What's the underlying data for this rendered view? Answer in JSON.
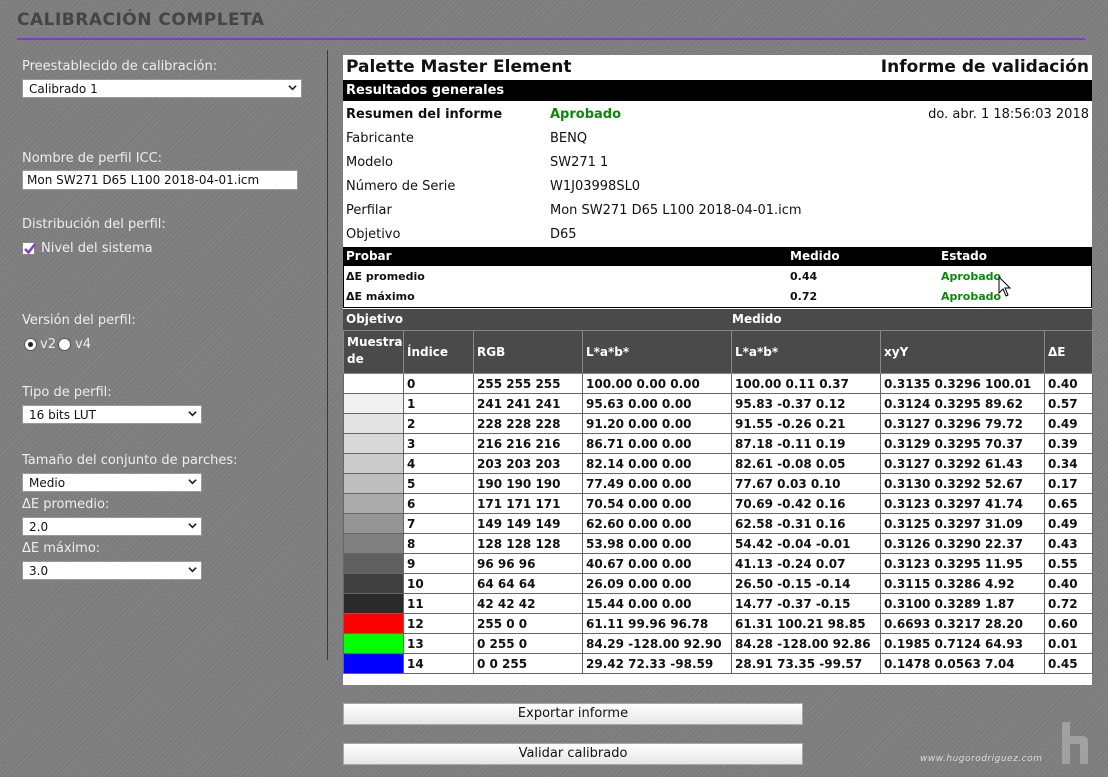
{
  "window": {
    "title": "CALIBRACIÓN COMPLETA"
  },
  "sidebar": {
    "preset_label": "Preestablecido de calibración:",
    "preset_value": "Calibrado 1",
    "icc_label": "Nombre de perfil ICC:",
    "icc_value": "Mon SW271 D65 L100 2018-04-01.icm",
    "distribution_label": "Distribución del perfil:",
    "system_level_label": "Nivel del sistema",
    "system_level_checked": true,
    "version_label": "Versión del perfil:",
    "version_options": [
      "v2",
      "v4"
    ],
    "version_selected": "v2",
    "profile_type_label": "Tipo de perfil:",
    "profile_type_value": "16 bits LUT",
    "patch_size_label": "Tamaño del conjunto de parches:",
    "patch_size_value": "Medio",
    "avg_de_label": "ΔE promedio:",
    "avg_de_value": "2.0",
    "max_de_label": "ΔE máximo:",
    "max_de_value": "3.0"
  },
  "report": {
    "app_title": "Palette Master Element",
    "report_title": "Informe de validación",
    "general_results": "Resultados generales",
    "summary_label": "Resumen del informe",
    "summary_status": "Aprobado",
    "timestamp": "do. abr. 1 18:56:03 2018",
    "info": [
      {
        "label": "Fabricante",
        "value": "BENQ"
      },
      {
        "label": "Modelo",
        "value": "SW271 1"
      },
      {
        "label": "Número de Serie",
        "value": "W1J03998SL0"
      },
      {
        "label": "Perfilar",
        "value": "Mon SW271 D65 L100 2018-04-01.icm"
      },
      {
        "label": "Objetivo",
        "value": "D65"
      }
    ],
    "test_header": {
      "probe": "Probar",
      "measured": "Medido",
      "status": "Estado"
    },
    "tests": [
      {
        "name": "ΔE promedio",
        "measured": "0.44",
        "status": "Aprobado"
      },
      {
        "name": "ΔE máximo",
        "measured": "0.72",
        "status": "Aprobado"
      }
    ],
    "target_label": "Objetivo",
    "measured_label": "Medido",
    "columns": {
      "sample": "Muestra de",
      "index": "Índice",
      "rgb": "RGB",
      "lab_target": "L*a*b*",
      "lab_measured": "L*a*b*",
      "xyy": "xyY",
      "de": "ΔE"
    },
    "rows": [
      {
        "color": "#ffffff",
        "idx": "0",
        "rgb": "255  255  255",
        "lab_t": "100.00  0.00  0.00",
        "lab_m": "100.00  0.11  0.37",
        "xyy": "0.3135  0.3296  100.01",
        "de": "0.40"
      },
      {
        "color": "#f1f1f1",
        "idx": "1",
        "rgb": "241  241  241",
        "lab_t": "95.63  0.00  0.00",
        "lab_m": "95.83  -0.37  0.12",
        "xyy": "0.3124  0.3295  89.62",
        "de": "0.57"
      },
      {
        "color": "#e4e4e4",
        "idx": "2",
        "rgb": "228  228  228",
        "lab_t": "91.20  0.00  0.00",
        "lab_m": "91.55  -0.26  0.21",
        "xyy": "0.3127  0.3296  79.72",
        "de": "0.49"
      },
      {
        "color": "#d8d8d8",
        "idx": "3",
        "rgb": "216  216  216",
        "lab_t": "86.71  0.00  0.00",
        "lab_m": "87.18  -0.11  0.19",
        "xyy": "0.3129  0.3295  70.37",
        "de": "0.39"
      },
      {
        "color": "#cbcbcb",
        "idx": "4",
        "rgb": "203  203  203",
        "lab_t": "82.14  0.00  0.00",
        "lab_m": "82.61  -0.08  0.05",
        "xyy": "0.3127  0.3292  61.43",
        "de": "0.34"
      },
      {
        "color": "#bebebe",
        "idx": "5",
        "rgb": "190  190  190",
        "lab_t": "77.49  0.00  0.00",
        "lab_m": "77.67  0.03  0.10",
        "xyy": "0.3130  0.3292  52.67",
        "de": "0.17"
      },
      {
        "color": "#ababab",
        "idx": "6",
        "rgb": "171  171  171",
        "lab_t": "70.54  0.00  0.00",
        "lab_m": "70.69  -0.42  0.16",
        "xyy": "0.3123  0.3297  41.74",
        "de": "0.65"
      },
      {
        "color": "#959595",
        "idx": "7",
        "rgb": "149  149  149",
        "lab_t": "62.60  0.00  0.00",
        "lab_m": "62.58  -0.31  0.16",
        "xyy": "0.3125  0.3297  31.09",
        "de": "0.49"
      },
      {
        "color": "#808080",
        "idx": "8",
        "rgb": "128  128  128",
        "lab_t": "53.98  0.00  0.00",
        "lab_m": "54.42  -0.04  -0.01",
        "xyy": "0.3126  0.3290  22.37",
        "de": "0.43"
      },
      {
        "color": "#606060",
        "idx": "9",
        "rgb": "96  96  96",
        "lab_t": "40.67  0.00  0.00",
        "lab_m": "41.13  -0.24  0.07",
        "xyy": "0.3123  0.3295  11.95",
        "de": "0.55"
      },
      {
        "color": "#404040",
        "idx": "10",
        "rgb": "64  64  64",
        "lab_t": "26.09  0.00  0.00",
        "lab_m": "26.50  -0.15  -0.14",
        "xyy": "0.3115  0.3286  4.92",
        "de": "0.40"
      },
      {
        "color": "#2a2a2a",
        "idx": "11",
        "rgb": "42  42  42",
        "lab_t": "15.44  0.00  0.00",
        "lab_m": "14.77  -0.37  -0.15",
        "xyy": "0.3100  0.3289  1.87",
        "de": "0.72"
      },
      {
        "color": "#ff0000",
        "idx": "12",
        "rgb": "255  0  0",
        "lab_t": "61.11  99.96  96.78",
        "lab_m": "61.31  100.21  98.85",
        "xyy": "0.6693  0.3217  28.20",
        "de": "0.60"
      },
      {
        "color": "#00ff00",
        "idx": "13",
        "rgb": "0  255  0",
        "lab_t": "84.29  -128.00  92.90",
        "lab_m": "84.28  -128.00  92.86",
        "xyy": "0.1985  0.7124  64.93",
        "de": "0.01"
      },
      {
        "color": "#0000ff",
        "idx": "14",
        "rgb": "0  0  255",
        "lab_t": "29.42  72.33  -98.59",
        "lab_m": "28.91  73.35  -99.57",
        "xyy": "0.1478  0.0563  7.04",
        "de": "0.45"
      }
    ]
  },
  "buttons": {
    "export": "Exportar informe",
    "validate": "Validar calibrado"
  },
  "footer": {
    "watermark": "www.hugorodriguez.com"
  },
  "colors": {
    "accent": "#7b3fc4",
    "pass": "#0a8a0a",
    "background": "#7e7e7e"
  }
}
